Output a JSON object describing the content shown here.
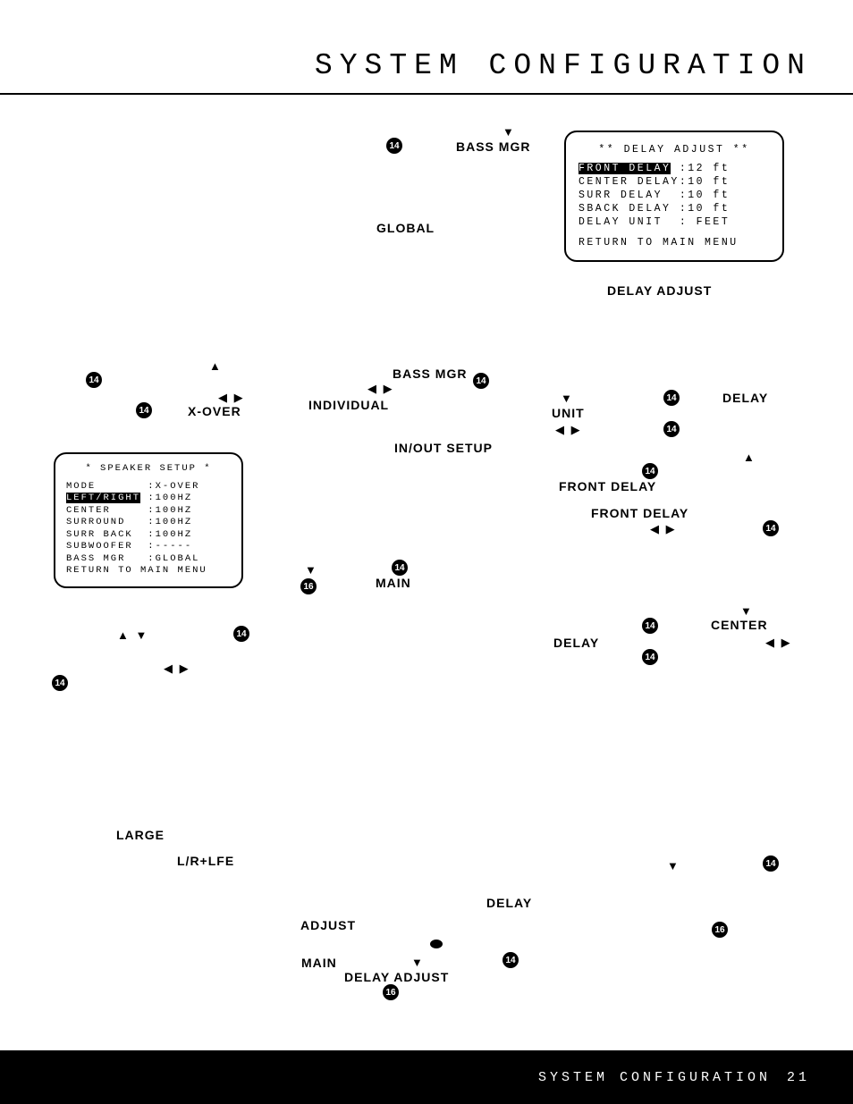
{
  "page_title": "SYSTEM CONFIGURATION",
  "footer": {
    "title": "SYSTEM CONFIGURATION",
    "page": "21"
  },
  "labels": {
    "bass_mgr_1": "BASS MGR",
    "global": "GLOBAL",
    "delay_adjust_caption": "DELAY ADJUST",
    "bass_mgr_2": "BASS MGR",
    "individual": "INDIVIDUAL",
    "in_out_setup": "IN/OUT SETUP",
    "x_over": "X-OVER",
    "main_1": "MAIN",
    "delay_1": "DELAY",
    "unit": "UNIT",
    "front_delay_1": "FRONT DELAY",
    "front_delay_2": "FRONT DELAY",
    "center": "CENTER",
    "delay_2": "DELAY",
    "large": "LARGE",
    "lr_lfe": "L/R+LFE",
    "delay_3": "DELAY",
    "adjust": "ADJUST",
    "main_2": "MAIN",
    "delay_adjust_2": "DELAY ADJUST"
  },
  "badges": {
    "n14": "14",
    "n16": "16"
  },
  "lcd_delay": {
    "title": "** DELAY ADJUST **",
    "rows": [
      {
        "label_sel": "FRONT DELAY",
        "rest": " :12 ft"
      },
      {
        "line": "CENTER DELAY:10 ft"
      },
      {
        "line": "SURR DELAY  :10 ft"
      },
      {
        "line": "SBACK DELAY :10 ft"
      },
      {
        "line": "DELAY UNIT  : FEET"
      }
    ],
    "return": "RETURN TO MAIN MENU"
  },
  "lcd_speaker": {
    "title": "* SPEAKER SETUP *",
    "rows": [
      {
        "line": "MODE       :X-OVER"
      },
      {
        "label_sel": "LEFT/RIGHT",
        "rest": " :100HZ"
      },
      {
        "line": "CENTER     :100HZ"
      },
      {
        "line": "SURROUND   :100HZ"
      },
      {
        "line": "SURR BACK  :100HZ"
      },
      {
        "line": "SUBWOOFER  :-----"
      },
      {
        "line": "BASS MGR   :GLOBAL"
      }
    ],
    "return": "RETURN TO MAIN MENU"
  },
  "arrows": {
    "down": "▼",
    "up": "▲",
    "lr": "◀ ▶",
    "ud": "▲ ▼"
  }
}
